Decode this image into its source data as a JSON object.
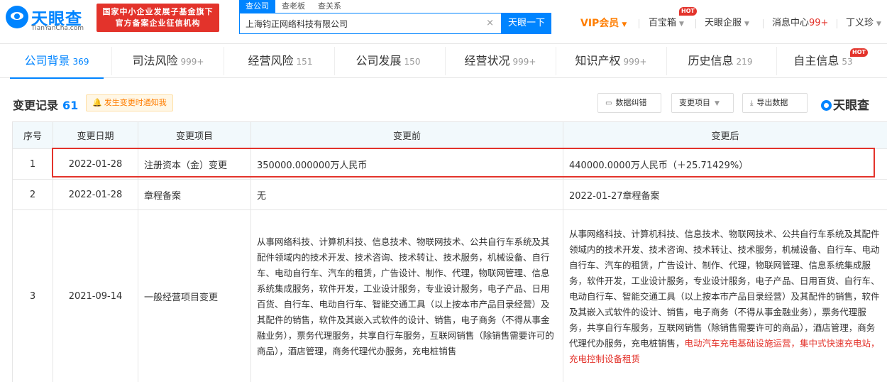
{
  "header": {
    "logo": {
      "text": "天眼查",
      "sub": "TianYanCha.com"
    },
    "gov_banner": [
      "国家中小企业发展子基金旗下",
      "官方备案企业征信机构"
    ],
    "search_tabs": [
      "查公司",
      "查老板",
      "查关系"
    ],
    "search_value": "上海钧正网络科技有限公司",
    "search_clear": "×",
    "search_button": "天眼一下",
    "nav": {
      "vip": "VIP会员",
      "baobao": "百宝箱",
      "qiyun": "天眼企服",
      "messages_label": "消息中心",
      "messages_count": "99+",
      "user": "丁义珍",
      "hot": "HOT"
    }
  },
  "module_tabs": [
    {
      "label": "公司背景",
      "count": "369"
    },
    {
      "label": "司法风险",
      "count": "999+"
    },
    {
      "label": "经营风险",
      "count": "151"
    },
    {
      "label": "公司发展",
      "count": "150"
    },
    {
      "label": "经营状况",
      "count": "999+"
    },
    {
      "label": "知识产权",
      "count": "999+"
    },
    {
      "label": "历史信息",
      "count": "219"
    },
    {
      "label": "自主信息",
      "count": "53"
    }
  ],
  "section": {
    "title": "变更记录",
    "count": "61",
    "notify": "发生变更时通知我",
    "buttons": {
      "error": "数据纠错",
      "item": "变更项目",
      "export": "导出数据"
    },
    "brand": "天眼查"
  },
  "table": {
    "headers": [
      "序号",
      "变更日期",
      "变更项目",
      "变更前",
      "变更后"
    ],
    "rows": [
      {
        "idx": "1",
        "date": "2022-01-28",
        "item": "注册资本（金）变更",
        "before": "350000.000000万人民币",
        "after": "440000.0000万人民币（＋25.71429%）"
      },
      {
        "idx": "2",
        "date": "2022-01-28",
        "item": "章程备案",
        "before": "无",
        "after": "2022-01-27章程备案"
      },
      {
        "idx": "3",
        "date": "2021-09-14",
        "item": "一般经营项目变更",
        "before": "从事网络科技、计算机科技、信息技术、物联网技术、公共自行车系统及其配件领域内的技术开发、技术咨询、技术转让、技术服务，机械设备、自行车、电动自行车、汽车的租赁，广告设计、制作、代理，物联网管理、信息系统集成服务，软件开发，工业设计服务，专业设计服务，电子产品、日用百货、自行车、电动自行车、智能交通工具（以上按本市产品目录经营）及其配件的销售，软件及其嵌入式软件的设计、销售，电子商务（不得从事金融业务），票务代理服务，共享自行车服务，互联网销售（除销售需要许可的商品），酒店管理，商务代理代办服务，充电桩销售",
        "after": "从事网络科技、计算机科技、信息技术、物联网技术、公共自行车系统及其配件领域内的技术开发、技术咨询、技术转让、技术服务，机械设备、自行车、电动自行车、汽车的租赁，广告设计、制作、代理，物联网管理、信息系统集成服务，软件开发，工业设计服务，专业设计服务，电子产品、日用百货、自行车、电动自行车、智能交通工具（以上按本市产品目录经营）及其配件的销售，软件及其嵌入式软件的设计、销售，电子商务（不得从事金融业务），票务代理服务，共享自行车服务，互联网销售（除销售需要许可的商品），酒店管理，商务代理代办服务，充电桩销售，",
        "after_added": "电动汽车充电基础设施运营，集中式快速充电站，充电控制设备租赁"
      }
    ]
  },
  "colors": {
    "brand_blue": "#0084ff",
    "red": "#e3332b",
    "vip_orange": "#ff7d00",
    "header_bg": "#f2f9fc"
  }
}
